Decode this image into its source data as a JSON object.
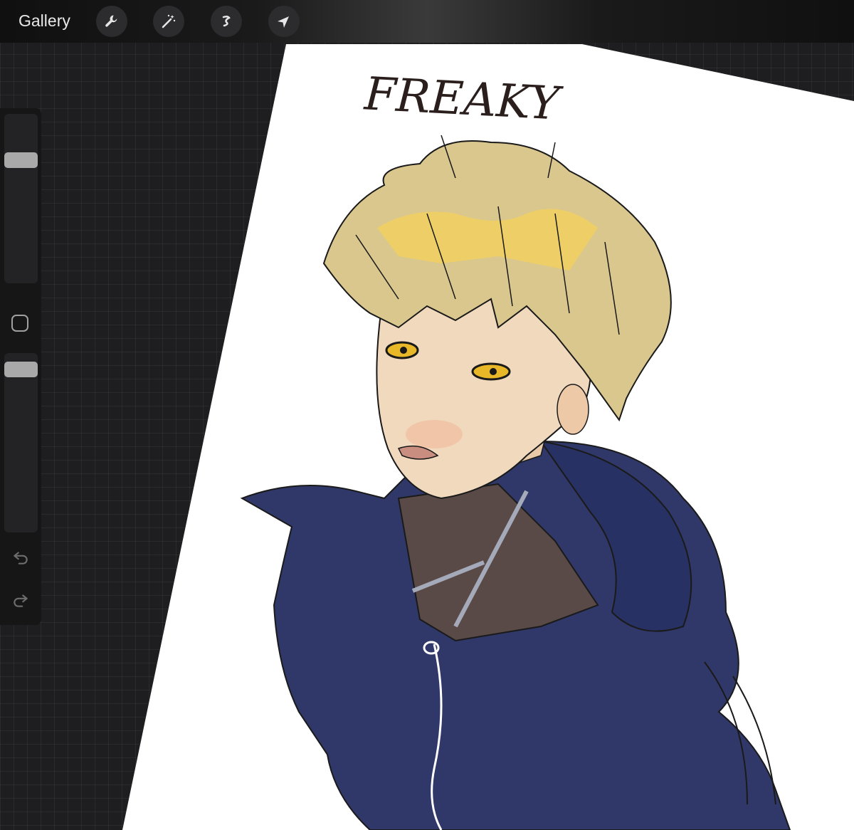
{
  "toolbar": {
    "gallery_label": "Gallery",
    "tools": [
      {
        "icon": "wrench-icon",
        "name": "actions"
      },
      {
        "icon": "magic-wand-icon",
        "name": "adjustments"
      },
      {
        "icon": "selection-icon",
        "name": "selection"
      },
      {
        "icon": "arrow-cursor-icon",
        "name": "transform"
      }
    ]
  },
  "sidebar": {
    "brush_size_level": 0.75,
    "opacity_level": 0.95,
    "icons": [
      "square-modify-icon",
      "undo-icon",
      "redo-icon"
    ]
  },
  "artwork": {
    "title_text": "FREAKY",
    "colors": {
      "hair": "#d9c78e",
      "hair_highlight": "#f4d15a",
      "skin": "#f1d9bd",
      "eyes": "#e8b829",
      "hoodie": "#2f3868",
      "collar": "#5a4a47",
      "lineart": "#1a1a1a"
    }
  }
}
